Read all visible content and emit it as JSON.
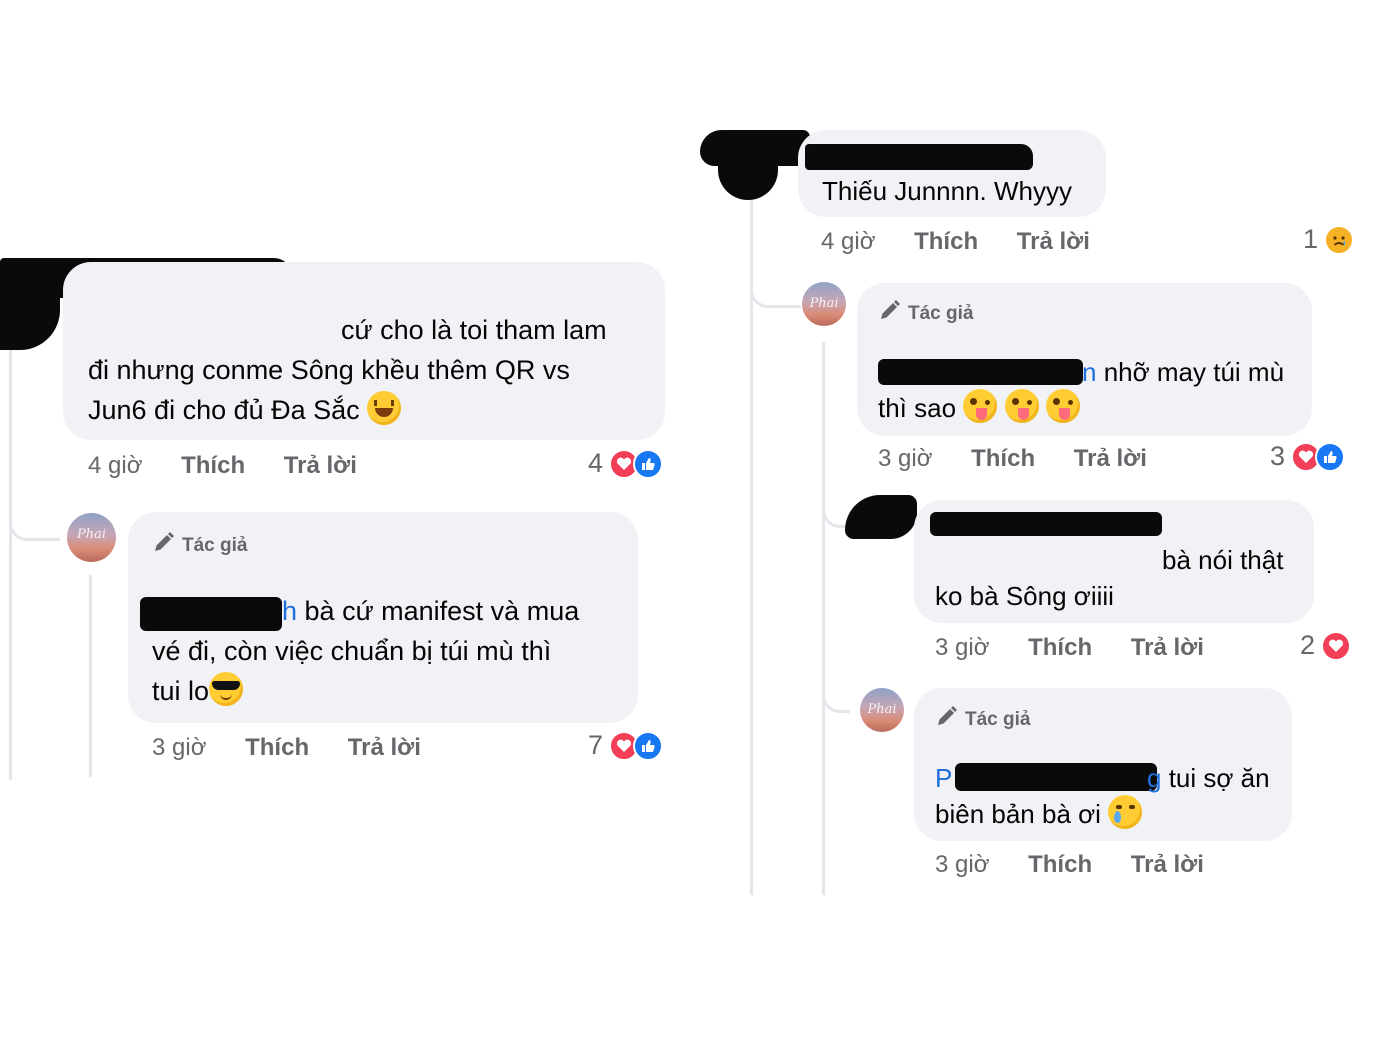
{
  "left": {
    "comment1": {
      "lines": [
        "cứ cho là toi tham lam",
        "đi nhưng conme Sông khều thêm QR vs",
        "Jun6 đi cho đủ Đa Sắc"
      ],
      "emoji": "laughing-emoji",
      "time": "4 giờ",
      "like": "Thích",
      "reply": "Trả lời",
      "reaction_count": "4",
      "reactions": [
        "heart",
        "like"
      ]
    },
    "reply1": {
      "author_badge": "Tác giả",
      "mention_tail": "h",
      "lines": [
        " bà cứ manifest và mua",
        "vé đi, còn việc chuẩn bị túi mù thì",
        "tui lo"
      ],
      "emoji": "sunglasses-emoji",
      "time": "3 giờ",
      "like": "Thích",
      "reply": "Trả lời",
      "reaction_count": "7",
      "reactions": [
        "heart",
        "like"
      ]
    }
  },
  "right": {
    "comment1": {
      "text": "Thiếu Junnnn. Whyyy",
      "time": "4 giờ",
      "like": "Thích",
      "reply": "Trả lời",
      "reaction_count": "1",
      "reactions": [
        "sad"
      ]
    },
    "reply1": {
      "author_badge": "Tác giả",
      "mention_tail": "n",
      "line1": " nhỡ may túi mù",
      "line2": "thì sao",
      "emoji": "zany-face-emoji",
      "time": "3 giờ",
      "like": "Thích",
      "reply": "Trả lời",
      "reaction_count": "3",
      "reactions": [
        "heart",
        "like"
      ]
    },
    "reply2": {
      "lines": [
        "bà nói thật",
        "ko bà Sông ơiiii"
      ],
      "time": "3 giờ",
      "like": "Thích",
      "reply": "Trả lời",
      "reaction_count": "2",
      "reactions": [
        "heart"
      ]
    },
    "reply3": {
      "author_badge": "Tác giả",
      "mention_head": "P",
      "mention_tail": "g",
      "line1": " tui sợ ăn",
      "line2": "biên bản bà ơi",
      "emoji": "crying-face-emoji",
      "time": "3 giờ",
      "like": "Thích",
      "reply": "Trả lời"
    }
  },
  "colors": {
    "bubble": "#f0f2f5",
    "meta": "#65676b",
    "mention": "#216fdb",
    "heart": "#f33e58",
    "like": "#1877f2"
  }
}
